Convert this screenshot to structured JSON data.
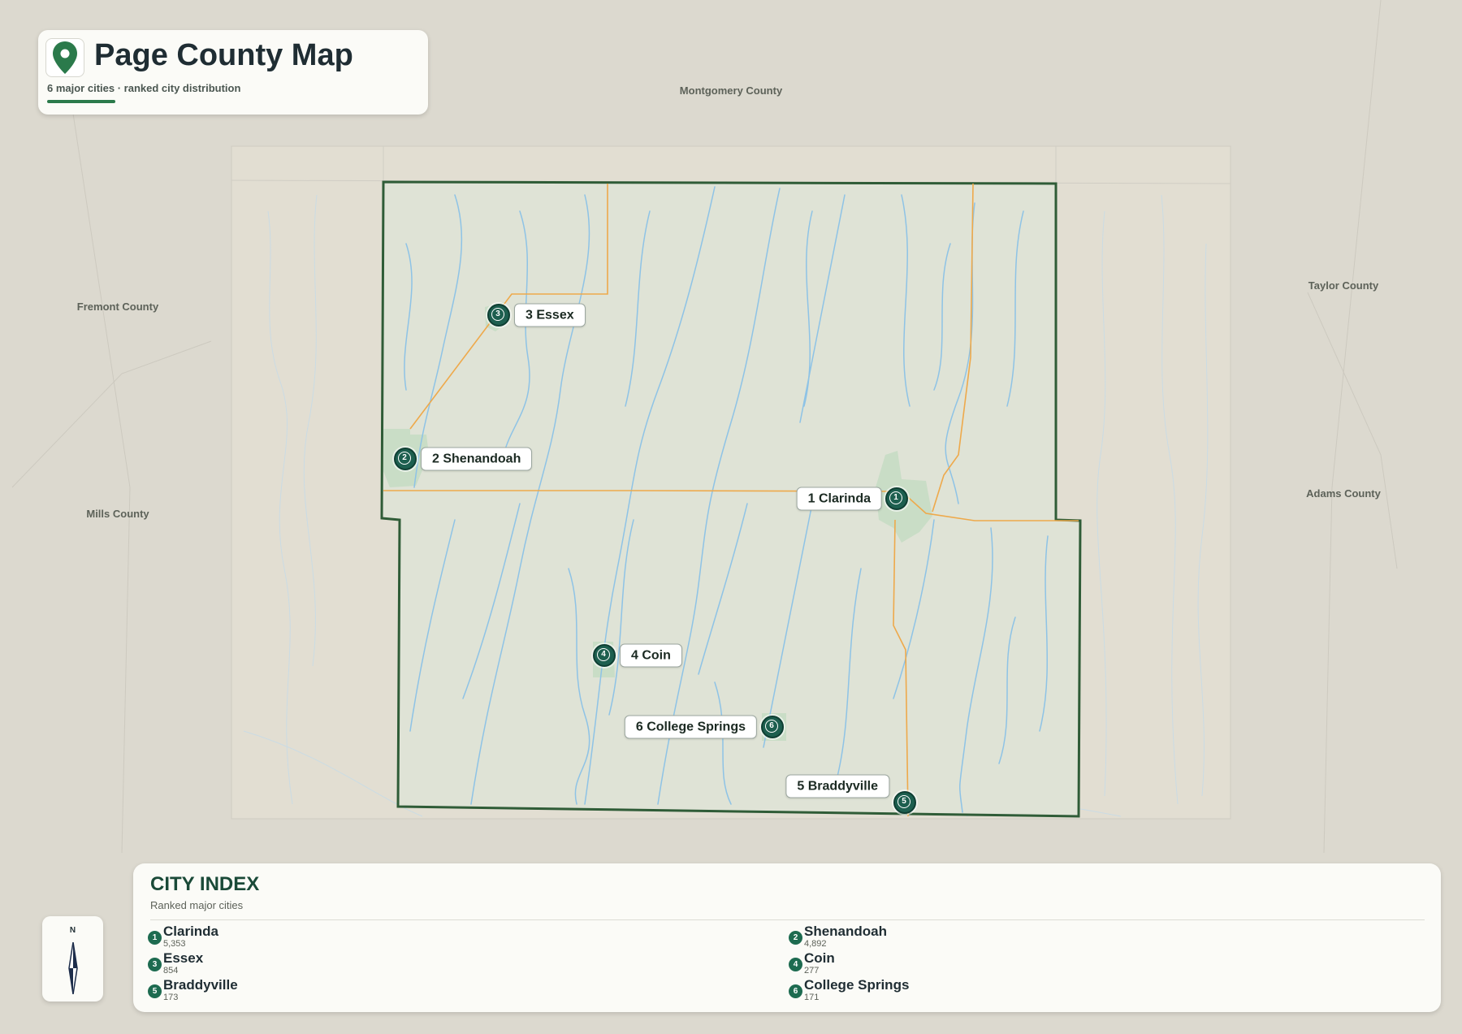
{
  "header": {
    "title": "Page County Map",
    "subtitle": "6 major cities · ranked city distribution",
    "icon": "map-pin-icon"
  },
  "colors": {
    "accent": "#2b7a4b",
    "county_border": "#2f5c37",
    "marker": "#1d5f4f",
    "river": "#8ec3e6",
    "road": "#eea94b",
    "county_fill": "#dfe3d6",
    "town_fill": "#c7dcc5"
  },
  "neighbors": [
    {
      "name": "Montgomery County"
    },
    {
      "name": "Fremont County"
    },
    {
      "name": "Mills County"
    },
    {
      "name": "Taylor County"
    },
    {
      "name": "Adams County"
    }
  ],
  "cities": [
    {
      "rank": "1",
      "name": "Clarinda",
      "label": "1 Clarinda",
      "population": "5,353"
    },
    {
      "rank": "2",
      "name": "Shenandoah",
      "label": "2 Shenandoah",
      "population": "4,892"
    },
    {
      "rank": "3",
      "name": "Essex",
      "label": "3 Essex",
      "population": "854"
    },
    {
      "rank": "4",
      "name": "Coin",
      "label": "4 Coin",
      "population": "277"
    },
    {
      "rank": "5",
      "name": "Braddyville",
      "label": "5 Braddyville",
      "population": "173"
    },
    {
      "rank": "6",
      "name": "College Springs",
      "label": "6 College Springs",
      "population": "171"
    }
  ],
  "compass": {
    "north": "N",
    "icon": "compass-arrow-icon"
  },
  "index": {
    "title": "CITY INDEX",
    "subtitle": "Ranked major cities"
  }
}
